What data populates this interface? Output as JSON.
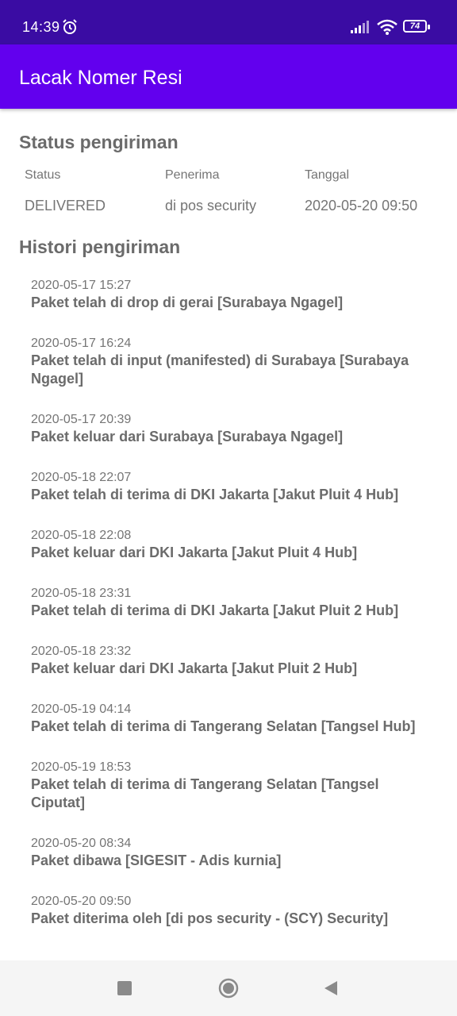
{
  "status_bar": {
    "time": "14:39",
    "battery": "74",
    "icons": [
      "alarm-icon",
      "signal-icon",
      "wifi-icon",
      "battery-icon"
    ]
  },
  "app_bar": {
    "title": "Lacak Nomer Resi"
  },
  "status_section": {
    "title": "Status pengiriman",
    "headers": [
      "Status",
      "Penerima",
      "Tanggal"
    ],
    "values": [
      "DELIVERED",
      "di pos security",
      "2020-05-20 09:50"
    ]
  },
  "history_section": {
    "title": "Histori pengiriman",
    "items": [
      {
        "datetime": "2020-05-17 15:27",
        "message": "Paket telah di drop di gerai [Surabaya Ngagel]"
      },
      {
        "datetime": "2020-05-17 16:24",
        "message": "Paket telah di input (manifested) di Surabaya [Surabaya Ngagel]"
      },
      {
        "datetime": "2020-05-17 20:39",
        "message": "Paket keluar dari Surabaya [Surabaya Ngagel]"
      },
      {
        "datetime": "2020-05-18 22:07",
        "message": "Paket telah di terima di DKI Jakarta [Jakut Pluit 4 Hub]"
      },
      {
        "datetime": "2020-05-18 22:08",
        "message": "Paket keluar dari DKI Jakarta [Jakut Pluit 4 Hub]"
      },
      {
        "datetime": "2020-05-18 23:31",
        "message": "Paket telah di terima di DKI Jakarta [Jakut Pluit 2 Hub]"
      },
      {
        "datetime": "2020-05-18 23:32",
        "message": "Paket keluar dari DKI Jakarta [Jakut Pluit 2 Hub]"
      },
      {
        "datetime": "2020-05-19 04:14",
        "message": "Paket telah di terima di Tangerang Selatan [Tangsel Hub]"
      },
      {
        "datetime": "2020-05-19 18:53",
        "message": "Paket telah di terima di Tangerang Selatan [Tangsel Ciputat]"
      },
      {
        "datetime": "2020-05-20 08:34",
        "message": "Paket dibawa [SIGESIT - Adis kurnia]"
      },
      {
        "datetime": "2020-05-20 09:50",
        "message": "Paket diterima oleh [di pos security - (SCY) Security]"
      }
    ]
  },
  "nav_bar": {
    "icons": [
      "recents-icon",
      "home-icon",
      "back-icon"
    ]
  }
}
